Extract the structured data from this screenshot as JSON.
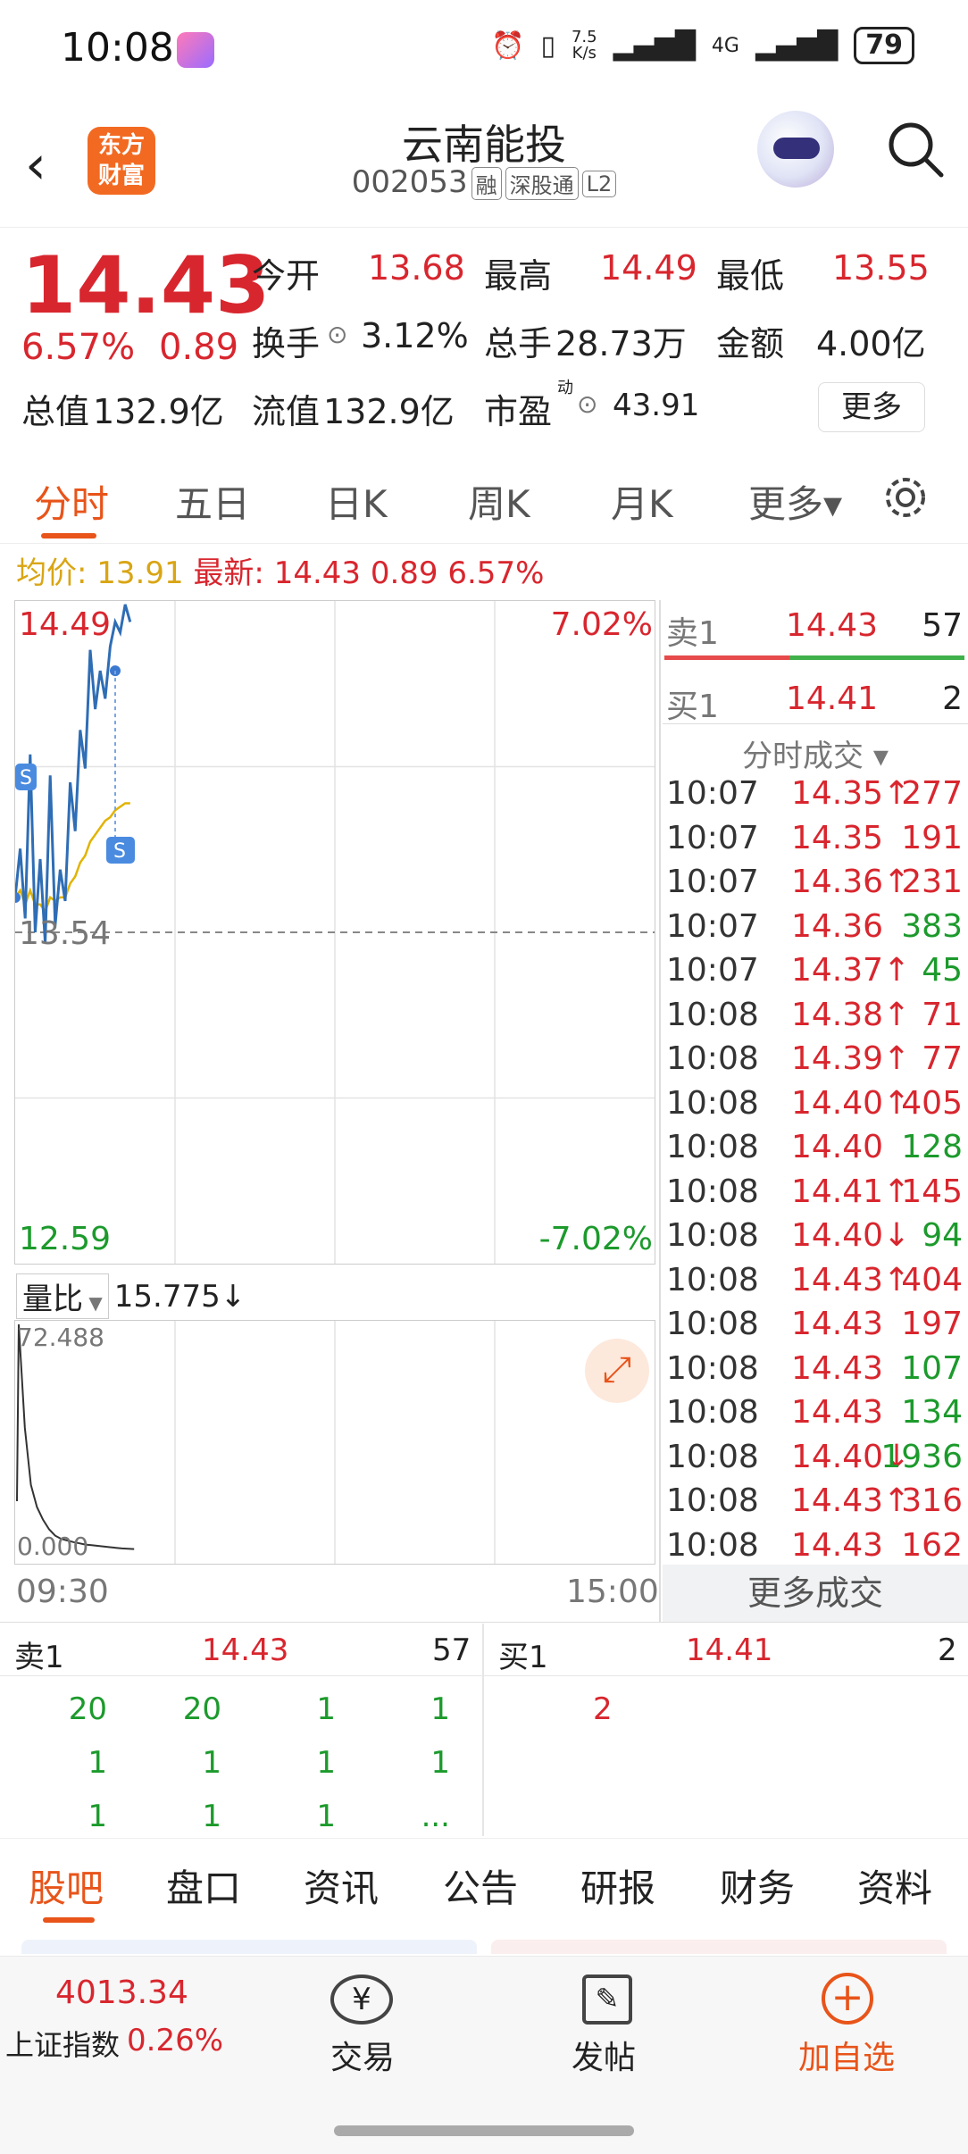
{
  "status": {
    "time": "10:08",
    "speed_top": "7.5",
    "speed_bottom": "K/s",
    "net": "4G",
    "battery": "79"
  },
  "header": {
    "back": "‹",
    "logo_line1": "东方",
    "logo_line2": "财富",
    "stock_name": "云南能投",
    "stock_code": "002053",
    "tags": [
      "融",
      "深股通",
      "L2"
    ]
  },
  "quote": {
    "price": "14.43",
    "pct": "6.57%",
    "change": "0.89",
    "open_label": "今开",
    "open": "13.68",
    "high_label": "最高",
    "high": "14.49",
    "low_label": "最低",
    "low": "13.55",
    "turnover_label": "换手",
    "turnover": "3.12%",
    "vol_label": "总手",
    "vol": "28.73万",
    "amount_label": "金额",
    "amount": "4.00亿",
    "mcap_label": "总值",
    "mcap": "132.9亿",
    "float_label": "流值",
    "float": "132.9亿",
    "pe_label": "市盈",
    "pe_sup": "动",
    "pe": "43.91",
    "more": "更多"
  },
  "tabs": [
    {
      "label": "分时"
    },
    {
      "label": "五日"
    },
    {
      "label": "日K"
    },
    {
      "label": "周K"
    },
    {
      "label": "月K"
    },
    {
      "label": "更多▾"
    }
  ],
  "avg_bar": {
    "avg_label": "均价:",
    "avg": "13.91",
    "latest_label": "最新:",
    "latest": "14.43 0.89 6.57%"
  },
  "chart": {
    "top_price": "14.49",
    "top_pct": "7.02%",
    "mid_price": "13.54",
    "bot_price": "12.59",
    "bot_pct": "-7.02%",
    "vr_label": "量比",
    "vr_value": "15.775↓",
    "vr_top": "72.488",
    "vr_bottom": "0.000",
    "t_start": "09:30",
    "t_end": "15:00"
  },
  "chart_data": {
    "type": "line",
    "title": "",
    "x_range": [
      "09:30",
      "15:00"
    ],
    "ylim": [
      12.59,
      14.49
    ],
    "prev_close": 13.54,
    "series": [
      {
        "values": [
          13.64,
          13.78,
          13.58,
          14.05,
          13.54,
          13.75,
          13.51,
          13.99,
          13.56,
          13.72,
          13.63,
          13.97,
          13.83,
          14.12,
          14.01,
          14.35,
          14.18,
          14.29,
          14.21,
          14.36,
          14.43,
          14.4,
          14.48,
          14.43
        ]
      },
      {
        "values": [
          13.64,
          13.66,
          13.62,
          13.66,
          13.62,
          13.62,
          13.6,
          13.64,
          13.63,
          13.64,
          13.64,
          13.68,
          13.7,
          13.74,
          13.76,
          13.8,
          13.82,
          13.84,
          13.86,
          13.87,
          13.89,
          13.9,
          13.91,
          13.91
        ]
      }
    ],
    "volume_ratio": [
      72.488,
      40,
      22,
      15,
      11,
      8,
      6,
      5,
      4.5,
      4,
      3.6,
      3.2,
      3.0,
      2.8,
      2.6,
      2.4,
      2.2,
      2.0,
      1.9,
      1.8
    ]
  },
  "orderbook": {
    "ask_label": "卖1",
    "ask_price": "14.43",
    "ask_vol": "57",
    "bid_label": "买1",
    "bid_price": "14.41",
    "bid_vol": "2",
    "trades_label": "分时成交 ▾",
    "more_trades": "更多成交"
  },
  "trades": [
    {
      "t": "10:07",
      "p": "14.35↑",
      "v": "277",
      "c": "red"
    },
    {
      "t": "10:07",
      "p": "14.35",
      "v": "191",
      "c": "red"
    },
    {
      "t": "10:07",
      "p": "14.36↑",
      "v": "231",
      "c": "red"
    },
    {
      "t": "10:07",
      "p": "14.36",
      "v": "383",
      "c": "green"
    },
    {
      "t": "10:07",
      "p": "14.37↑",
      "v": "45",
      "c": "green"
    },
    {
      "t": "10:08",
      "p": "14.38↑",
      "v": "71",
      "c": "red"
    },
    {
      "t": "10:08",
      "p": "14.39↑",
      "v": "77",
      "c": "red"
    },
    {
      "t": "10:08",
      "p": "14.40↑",
      "v": "405",
      "c": "red"
    },
    {
      "t": "10:08",
      "p": "14.40",
      "v": "128",
      "c": "green"
    },
    {
      "t": "10:08",
      "p": "14.41↑",
      "v": "145",
      "c": "red"
    },
    {
      "t": "10:08",
      "p": "14.40↓",
      "v": "94",
      "c": "green"
    },
    {
      "t": "10:08",
      "p": "14.43↑",
      "v": "404",
      "c": "red"
    },
    {
      "t": "10:08",
      "p": "14.43",
      "v": "197",
      "c": "red"
    },
    {
      "t": "10:08",
      "p": "14.43",
      "v": "107",
      "c": "green"
    },
    {
      "t": "10:08",
      "p": "14.43",
      "v": "134",
      "c": "green"
    },
    {
      "t": "10:08",
      "p": "14.40↓",
      "v": "1936",
      "c": "green"
    },
    {
      "t": "10:08",
      "p": "14.43↑",
      "v": "316",
      "c": "red"
    },
    {
      "t": "10:08",
      "p": "14.43",
      "v": "162",
      "c": "red"
    }
  ],
  "queue": {
    "ask_label": "卖1",
    "ask_price": "14.43",
    "ask_vol": "57",
    "bid_label": "买1",
    "bid_price": "14.41",
    "bid_vol": "2",
    "ask_rows": [
      [
        "20",
        "20",
        "1",
        "1"
      ],
      [
        "1",
        "1",
        "1",
        "1"
      ],
      [
        "1",
        "1",
        "1",
        "..."
      ]
    ],
    "bid_rows": [
      [
        "2"
      ]
    ]
  },
  "bottom_tabs": [
    {
      "label": "股吧"
    },
    {
      "label": "盘口"
    },
    {
      "label": "资讯"
    },
    {
      "label": "公告"
    },
    {
      "label": "研报"
    },
    {
      "label": "财务"
    },
    {
      "label": "资料"
    }
  ],
  "dock": {
    "index_value": "4013.34",
    "index_name": "上证指数",
    "index_pct": "0.26%",
    "trade": "交易",
    "post": "发帖",
    "add": "加自选"
  }
}
